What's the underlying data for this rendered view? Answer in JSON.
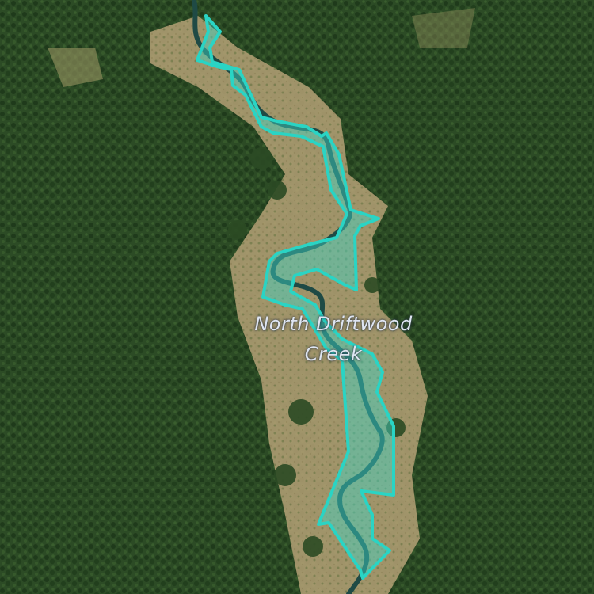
{
  "map": {
    "label": {
      "line1": "North Driftwood",
      "line2": "Creek"
    },
    "colors": {
      "forest_dark": "#24401f",
      "forest_mid": "#2f5228",
      "meadow": "#b8a47a",
      "creek_water": "#1f4a45",
      "highlight_stroke": "#2ad4c4",
      "highlight_fill": "#3fd6c8",
      "label_text": "#dfe6f2"
    },
    "highlighted_feature": "creek-polygon",
    "background": "satellite-imagery"
  }
}
